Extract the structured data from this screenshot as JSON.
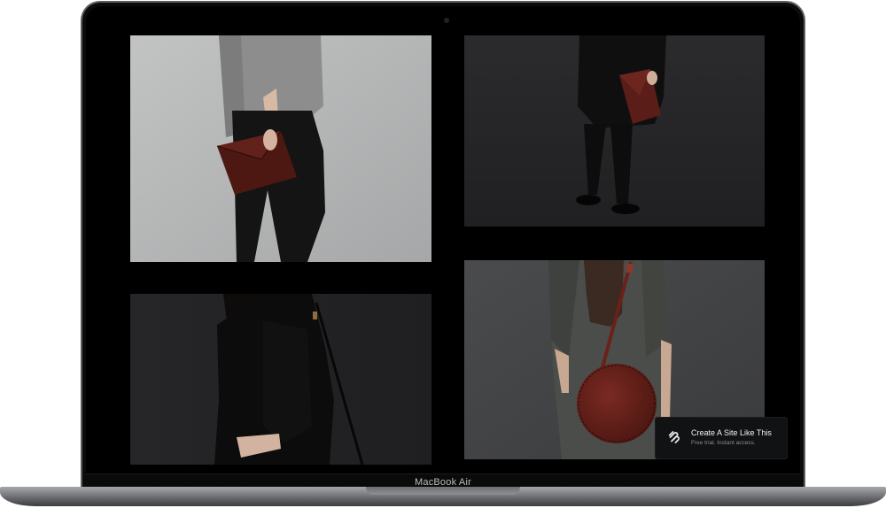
{
  "device": {
    "model_label": "MacBook Air"
  },
  "gallery": {
    "images": [
      {
        "subject": "woman in grey sweater holding dark red leather clutch"
      },
      {
        "subject": "person in black coat carrying red envelope clutch"
      },
      {
        "subject": "side view of woman in black dress with shoulder strap"
      },
      {
        "subject": "woman in grey shirt with round red leather crossbody bag"
      }
    ]
  },
  "badge": {
    "title": "Create A Site Like This",
    "subtitle": "Free trial. Instant access.",
    "icon": "squarespace-logo-icon"
  },
  "colors": {
    "bezel": "#0b0b0c",
    "leather": "#5c1c17",
    "badge_bg": "#111214"
  }
}
